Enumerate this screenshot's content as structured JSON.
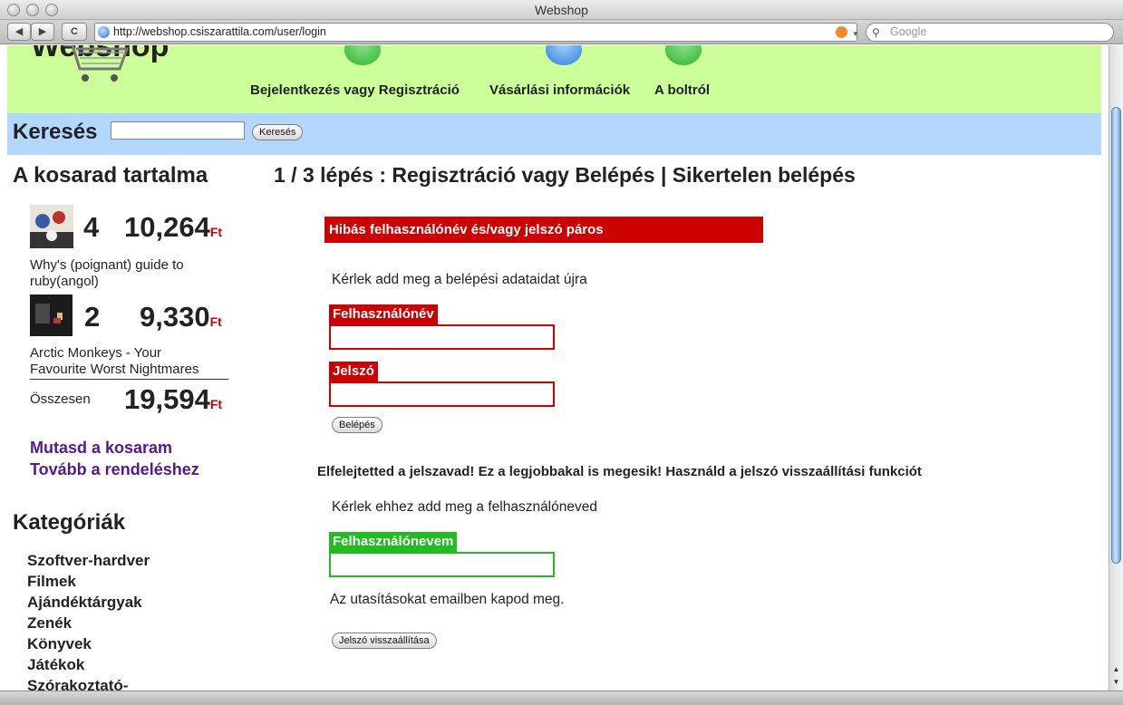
{
  "window": {
    "title": "Webshop"
  },
  "toolbar": {
    "url": "http://webshop.csiszarattila.com/user/login",
    "search_placeholder": "Google",
    "back_glyph": "◀",
    "forward_glyph": "▶",
    "reload_glyph": "C"
  },
  "header": {
    "logo_text": "Webshop",
    "menu": [
      {
        "label": "Bejelentkezés vagy Regisztráció",
        "icon": "green-check-icon",
        "color": "#2db52d"
      },
      {
        "label": "Vásárlási információk",
        "icon": "blue-info-icon",
        "color": "#2f7fd6"
      },
      {
        "label": "A boltról",
        "icon": "green-shop-icon",
        "color": "#2db52d"
      }
    ]
  },
  "search": {
    "label": "Keresés",
    "button": "Keresés",
    "value": ""
  },
  "cart": {
    "title": "A kosarad tartalma",
    "items": [
      {
        "qty": "4",
        "price": "10,264",
        "currency": "Ft",
        "name": "Why's (poignant) guide to ruby(angol)"
      },
      {
        "qty": "2",
        "price": "9,330",
        "currency": "Ft",
        "name": "Arctic Monkeys - Your Favourite Worst Nightmares"
      }
    ],
    "total_label": "Összesen",
    "total_price": "19,594",
    "total_currency": "Ft",
    "links": [
      "Mutasd a kosaram",
      "Tovább a rendeléshez"
    ]
  },
  "categories": {
    "title": "Kategóriák",
    "items": [
      "Szoftver-hardver",
      "Filmek",
      "Ajándéktárgyak",
      "Zenék",
      "Könyvek",
      "Játékok",
      "Szórakoztató-"
    ]
  },
  "main": {
    "title": "1 / 3 lépés : Regisztráció vagy Belépés | Sikertelen belépés",
    "error": "Hibás felhasználónév és/vagy jelszó páros",
    "retry_text": "Kérlek add meg a belépési adataidat újra",
    "username_label": "Felhasználónév",
    "username_value": "",
    "password_label": "Jelszó",
    "password_value": "",
    "login_button": "Belépés",
    "forgot_heading": "Elfelejtetted a jelszavad! Ez a legjobbakal is megesik! Használd a jelszó visszaállítási funkciót",
    "forgot_text": "Kérlek ehhez add meg a felhasználóneved",
    "forgot_label": "Felhasználónevem",
    "forgot_value": "",
    "email_note": "Az utasításokat emailben kapod meg.",
    "reset_button": "Jelszó visszaállítása"
  },
  "colors": {
    "header_bg": "#ccff99",
    "search_bg": "#b3d7ff",
    "error_red": "#cc0000",
    "reset_green": "#22bb22",
    "link_purple": "#551a8b"
  }
}
